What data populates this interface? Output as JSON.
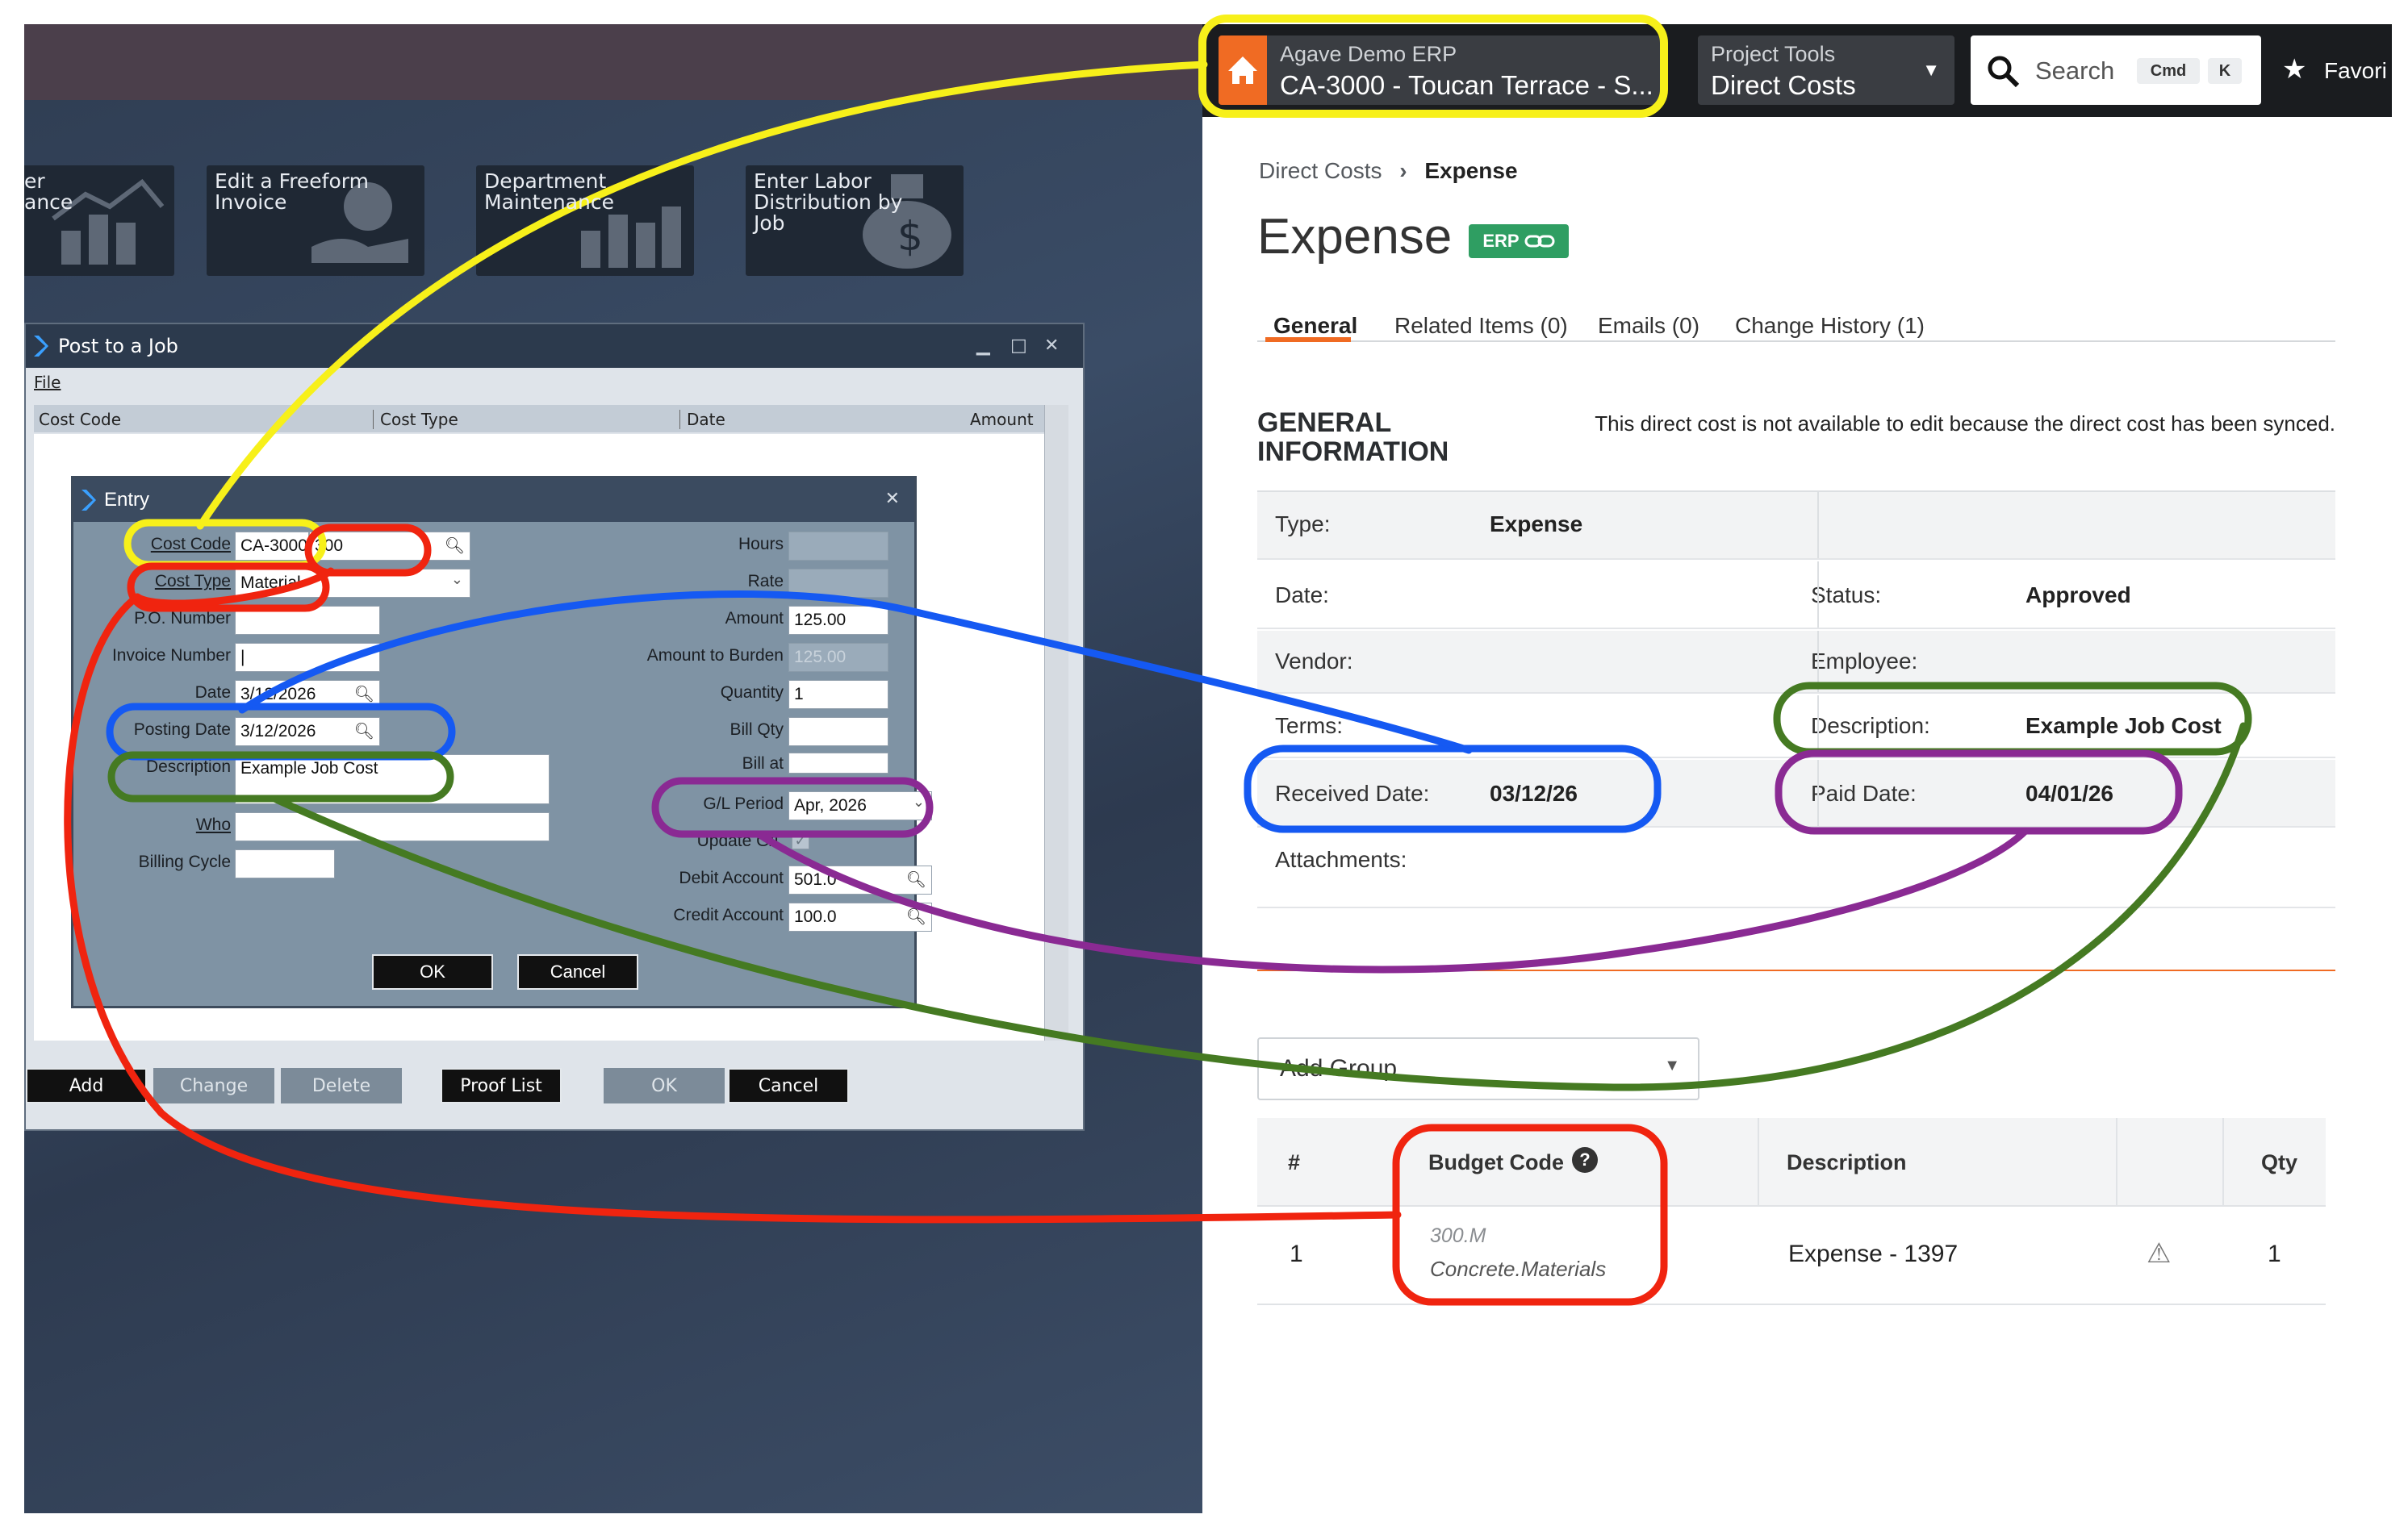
{
  "legacy": {
    "tiles": [
      {
        "label": "er\nance"
      },
      {
        "label": "Edit a Freeform Invoice"
      },
      {
        "label": "Department Maintenance"
      },
      {
        "label": "Enter Labor Distribution by Job"
      }
    ],
    "post_window": {
      "title": "Post to a Job",
      "menu_file": "File",
      "columns": [
        "Cost Code",
        "Cost Type",
        "Date",
        "Amount"
      ],
      "buttons": [
        "Add",
        "Change",
        "Delete",
        "Proof List",
        "OK",
        "Cancel"
      ]
    },
    "entry": {
      "title": "Entry",
      "cost_code_label": "Cost Code",
      "cost_code_value": "CA-3000",
      "cost_code_sub": "300",
      "cost_type_label": "Cost Type",
      "cost_type_value": "Material",
      "po_label": "P.O. Number",
      "invoice_label": "Invoice Number",
      "date_label": "Date",
      "date_value": "3/12/2026",
      "posting_date_label": "Posting Date",
      "posting_date_value": "3/12/2026",
      "description_label": "Description",
      "description_value": "Example Job Cost",
      "who_label": "Who",
      "billing_cycle_label": "Billing Cycle",
      "hours_label": "Hours",
      "rate_label": "Rate",
      "amount_label": "Amount",
      "amount_value": "125.00",
      "amount_to_burden_label": "Amount to Burden",
      "amount_to_burden_value": "125.00",
      "quantity_label": "Quantity",
      "quantity_value": "1",
      "bill_qty_label": "Bill Qty",
      "bill_at_label": "Bill at",
      "gl_period_label": "G/L Period",
      "gl_period_value": "Apr, 2026",
      "update_gl_label": "Update G/L",
      "debit_label": "Debit Account",
      "debit_value": "501.0",
      "credit_label": "Credit Account",
      "credit_value": "100.0",
      "ok": "OK",
      "cancel": "Cancel"
    }
  },
  "agave": {
    "project": {
      "company": "Agave Demo ERP",
      "name": "CA-3000 - Toucan Terrace - S..."
    },
    "tools": {
      "label": "Project Tools",
      "value": "Direct Costs"
    },
    "search": {
      "placeholder": "Search",
      "kbd1": "Cmd",
      "kbd2": "K"
    },
    "favorites": "Favori",
    "breadcrumb": {
      "parent": "Direct Costs",
      "current": "Expense"
    },
    "title": "Expense",
    "badge": "ERP",
    "tabs": [
      "General",
      "Related Items (0)",
      "Emails (0)",
      "Change History (1)"
    ],
    "section_title": "GENERAL INFORMATION",
    "sync_note": "This direct cost is not available to edit because the direct cost has been synced.",
    "fields": {
      "type_label": "Type:",
      "type_value": "Expense",
      "date_label": "Date:",
      "status_label": "Status:",
      "status_value": "Approved",
      "vendor_label": "Vendor:",
      "employee_label": "Employee:",
      "terms_label": "Terms:",
      "description_label": "Description:",
      "description_value": "Example Job Cost",
      "received_label": "Received Date:",
      "received_value": "03/12/26",
      "paid_label": "Paid Date:",
      "paid_value": "04/01/26",
      "attachments_label": "Attachments:"
    },
    "add_group": "Add Group",
    "table": {
      "headers": [
        "#",
        "Budget Code",
        "Description",
        "Qty"
      ],
      "rows": [
        {
          "num": "1",
          "code": "300.M",
          "code_name": "Concrete.Materials",
          "description": "Expense - 1397",
          "qty": "1"
        }
      ]
    }
  },
  "colors": {
    "yellow": "#f7f01a",
    "red": "#f0240f",
    "blue": "#1559f2",
    "green": "#457a22",
    "purple": "#8a2a93",
    "orange": "#f06b23",
    "erp_green": "#2f9e62"
  }
}
